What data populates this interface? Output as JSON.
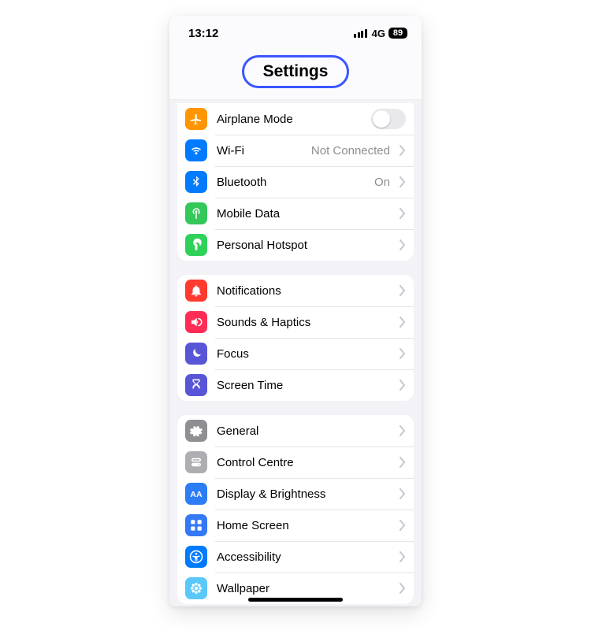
{
  "statusBar": {
    "time": "13:12",
    "network": "4G",
    "battery": "89"
  },
  "header": {
    "title": "Settings"
  },
  "groups": [
    {
      "rows": [
        {
          "id": "airplane",
          "label": "Airplane Mode",
          "icon": "airplane",
          "bg": "bg-orange",
          "control": "toggle"
        },
        {
          "id": "wifi",
          "label": "Wi-Fi",
          "detail": "Not Connected",
          "icon": "wifi",
          "bg": "bg-blue",
          "control": "disclosure"
        },
        {
          "id": "bluetooth",
          "label": "Bluetooth",
          "detail": "On",
          "icon": "bluetooth",
          "bg": "bg-blue",
          "control": "disclosure"
        },
        {
          "id": "mobiledata",
          "label": "Mobile Data",
          "icon": "antenna",
          "bg": "bg-green",
          "control": "disclosure"
        },
        {
          "id": "hotspot",
          "label": "Personal Hotspot",
          "icon": "hotspot",
          "bg": "bg-green2",
          "control": "disclosure"
        }
      ]
    },
    {
      "rows": [
        {
          "id": "notifications",
          "label": "Notifications",
          "icon": "bell",
          "bg": "bg-red",
          "control": "disclosure"
        },
        {
          "id": "sounds",
          "label": "Sounds & Haptics",
          "icon": "speaker",
          "bg": "bg-pink",
          "control": "disclosure"
        },
        {
          "id": "focus",
          "label": "Focus",
          "icon": "moon",
          "bg": "bg-indigo",
          "control": "disclosure"
        },
        {
          "id": "screentime",
          "label": "Screen Time",
          "icon": "hourglass",
          "bg": "bg-indigo",
          "control": "disclosure"
        }
      ]
    },
    {
      "rows": [
        {
          "id": "general",
          "label": "General",
          "icon": "gear",
          "bg": "bg-gray",
          "control": "disclosure"
        },
        {
          "id": "controlcentre",
          "label": "Control Centre",
          "icon": "switches",
          "bg": "bg-graylight",
          "control": "disclosure"
        },
        {
          "id": "display",
          "label": "Display & Brightness",
          "icon": "aa",
          "bg": "bg-blue2",
          "control": "disclosure"
        },
        {
          "id": "homescreen",
          "label": "Home Screen",
          "icon": "grid",
          "bg": "bg-bluehome",
          "control": "disclosure"
        },
        {
          "id": "accessibility",
          "label": "Accessibility",
          "icon": "accessibility",
          "bg": "bg-blue",
          "control": "disclosure"
        },
        {
          "id": "wallpaper",
          "label": "Wallpaper",
          "icon": "flower",
          "bg": "bg-cyan",
          "control": "disclosure"
        }
      ]
    }
  ]
}
